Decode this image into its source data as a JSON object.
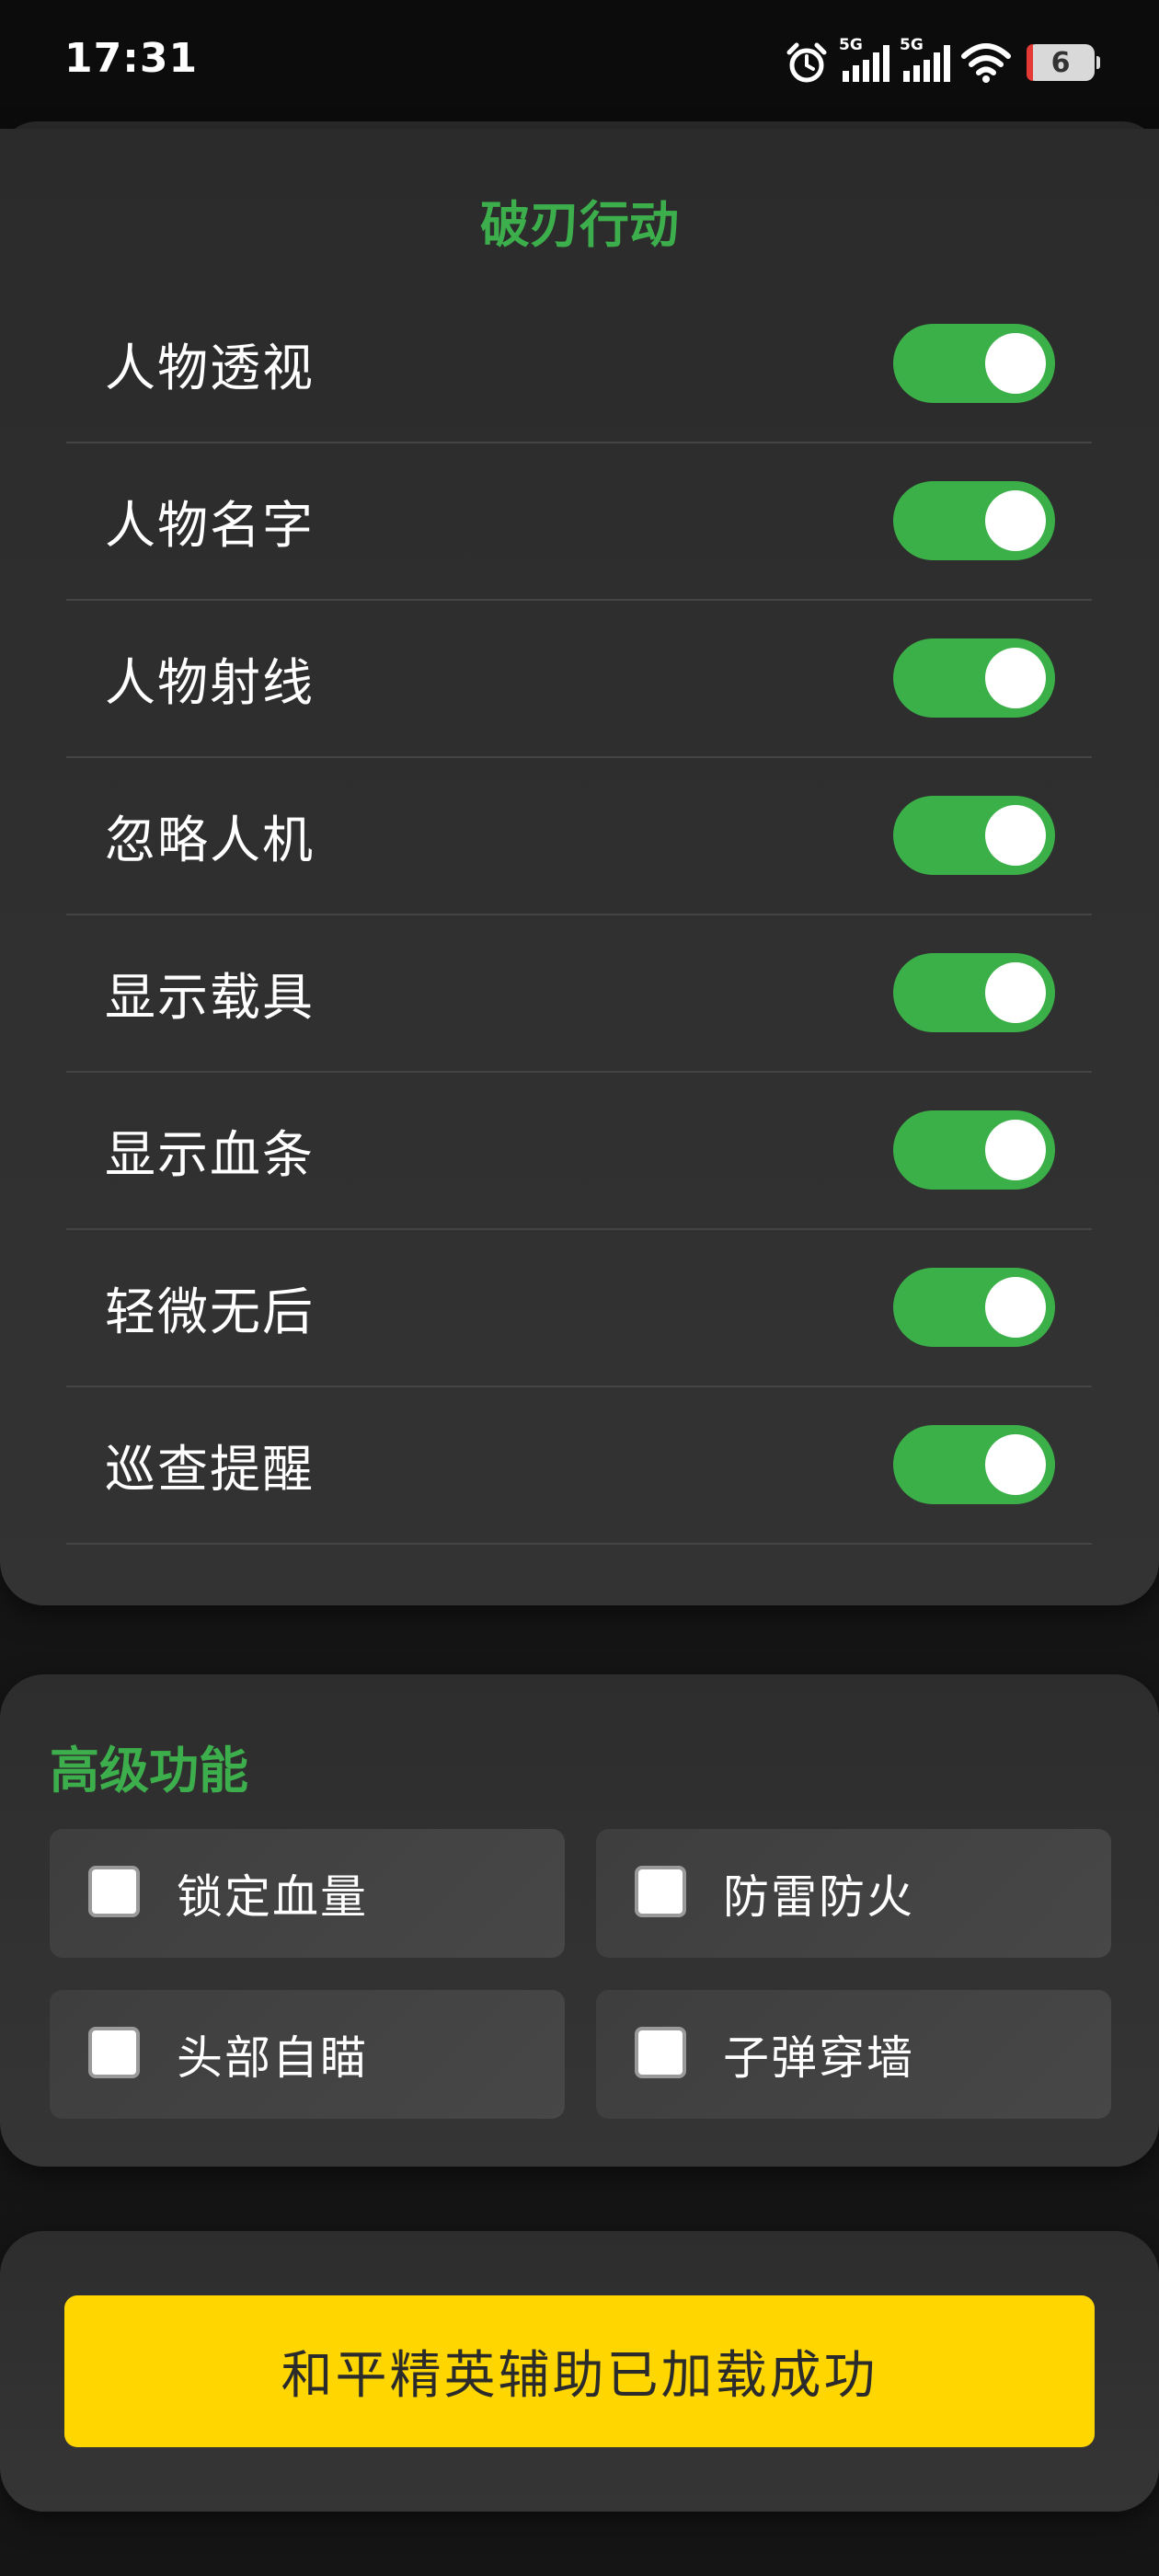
{
  "status_bar": {
    "time": "17:31",
    "network_1": "5G",
    "network_2": "5G",
    "battery": "6"
  },
  "main": {
    "title": "破刃行动",
    "toggles": [
      {
        "label": "人物透视",
        "on": true
      },
      {
        "label": "人物名字",
        "on": true
      },
      {
        "label": "人物射线",
        "on": true
      },
      {
        "label": "忽略人机",
        "on": true
      },
      {
        "label": "显示载具",
        "on": true
      },
      {
        "label": "显示血条",
        "on": true
      },
      {
        "label": "轻微无后",
        "on": true
      },
      {
        "label": "巡查提醒",
        "on": true
      }
    ]
  },
  "advanced": {
    "title": "高级功能",
    "options": [
      {
        "label": "锁定血量",
        "checked": false
      },
      {
        "label": "防雷防火",
        "checked": false
      },
      {
        "label": "头部自瞄",
        "checked": false
      },
      {
        "label": "子弹穿墙",
        "checked": false
      }
    ]
  },
  "footer": {
    "status_button": "和平精英辅助已加载成功"
  },
  "colors": {
    "accent_green": "#3dae4c",
    "toggle_on": "#3cb048",
    "button_yellow": "#ffd600",
    "battery_low": "#e53935"
  },
  "icons": [
    "alarm-icon",
    "signal-icon",
    "wifi-icon",
    "battery-icon"
  ]
}
